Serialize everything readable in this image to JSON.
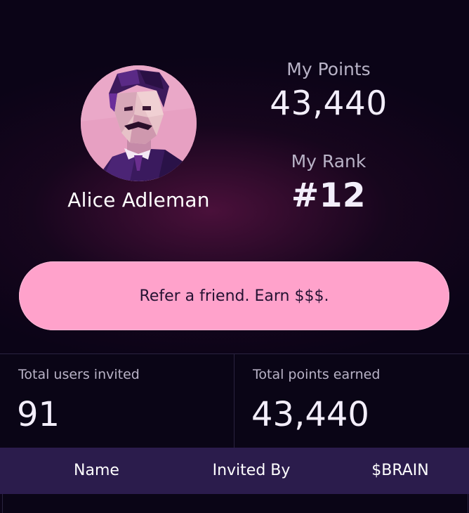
{
  "profile": {
    "name": "Alice Adleman",
    "avatar_icon": "low-poly-portrait-avatar"
  },
  "stats": {
    "points_label": "My Points",
    "points_value": "43,440",
    "rank_label": "My Rank",
    "rank_value": "#12"
  },
  "refer": {
    "label": "Refer a friend. Earn $$$."
  },
  "totals": {
    "users_label": "Total users invited",
    "users_value": "91",
    "points_label": "Total points earned",
    "points_value": "43,440"
  },
  "table": {
    "headers": [
      "Name",
      "Invited By",
      "$BRAIN"
    ]
  },
  "colors": {
    "background": "#0b0417",
    "accent_pink": "#ffa2cb",
    "table_header": "#2b1c4c"
  }
}
